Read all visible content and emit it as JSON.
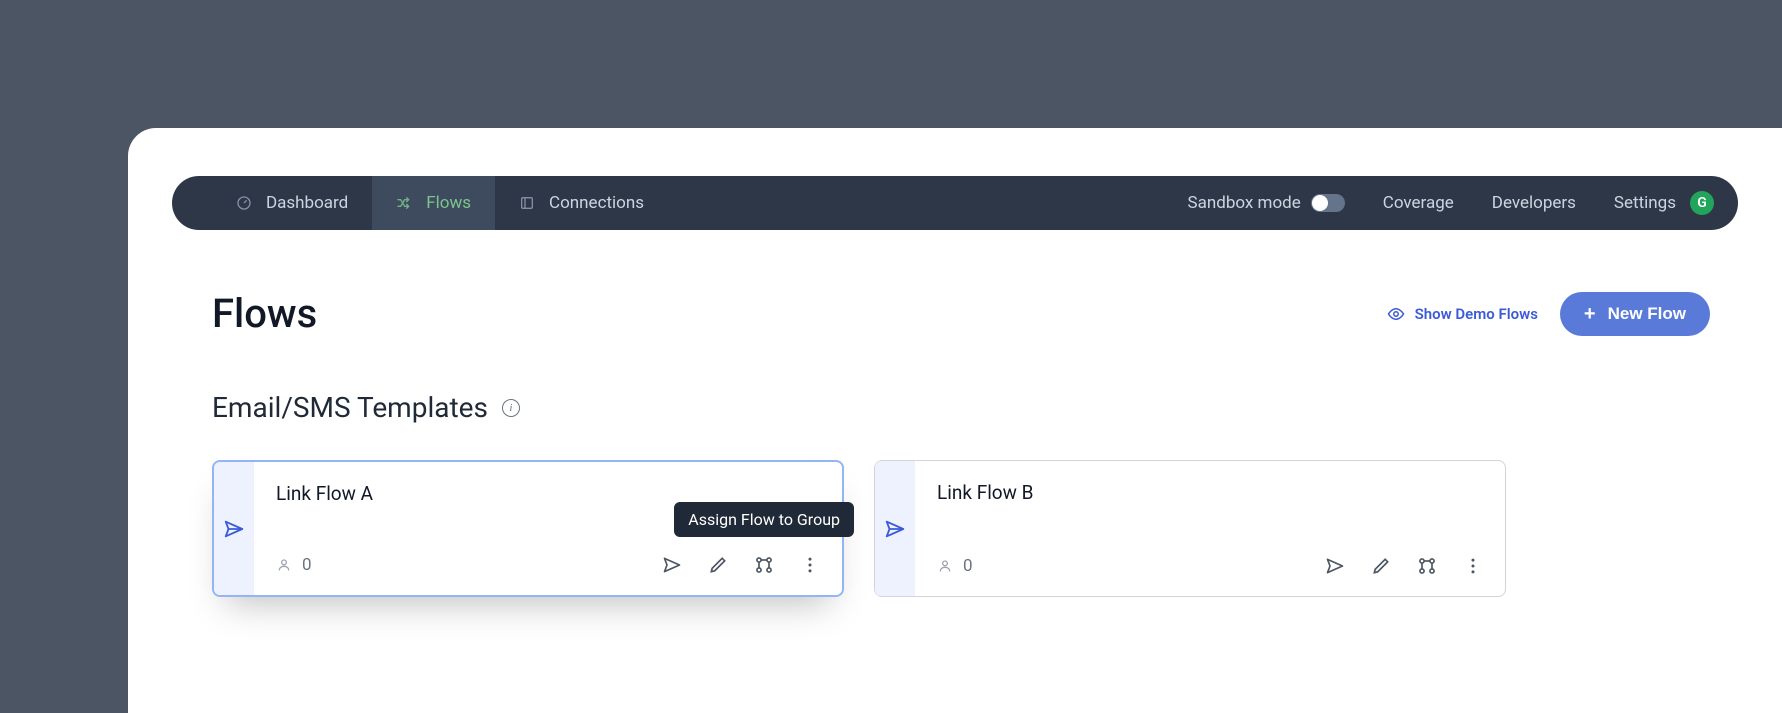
{
  "nav": {
    "items": [
      {
        "label": "Dashboard",
        "icon": "dashboard-icon"
      },
      {
        "label": "Flows",
        "icon": "shuffle-icon"
      },
      {
        "label": "Connections",
        "icon": "connections-icon"
      }
    ],
    "sandbox_label": "Sandbox mode",
    "links": {
      "coverage": "Coverage",
      "developers": "Developers",
      "settings": "Settings"
    },
    "avatar_initial": "G"
  },
  "page": {
    "title": "Flows",
    "show_demo_label": "Show Demo Flows",
    "new_flow_label": "New Flow"
  },
  "section": {
    "title": "Email/SMS Templates"
  },
  "flows": [
    {
      "title": "Link Flow A",
      "users": "0",
      "tooltip": "Assign Flow to Group"
    },
    {
      "title": "Link Flow B",
      "users": "0"
    }
  ]
}
